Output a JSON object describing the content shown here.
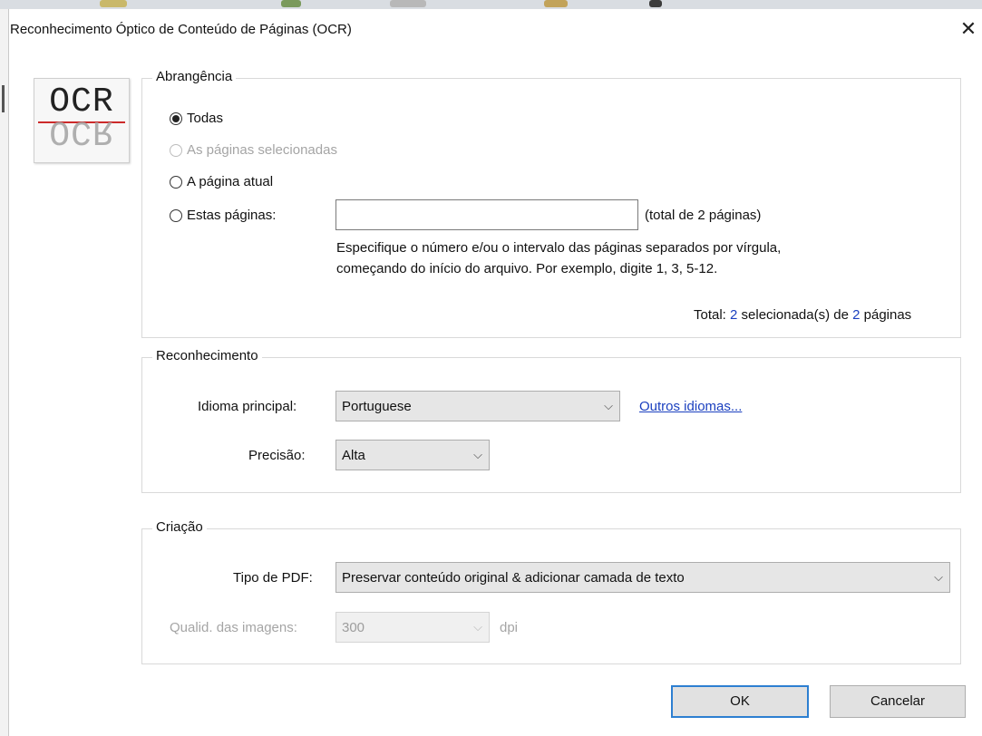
{
  "dialog": {
    "title": "Reconhecimento Óptico de Conteúdo de Páginas (OCR)",
    "close_label": "✕"
  },
  "logo": {
    "text": "OCR",
    "accent_color": "#cc2a2a"
  },
  "scope": {
    "legend": "Abrangência",
    "options": [
      {
        "label": "Todas",
        "checked": true,
        "enabled": true
      },
      {
        "label": "As páginas selecionadas",
        "checked": false,
        "enabled": false
      },
      {
        "label": "A página atual",
        "checked": false,
        "enabled": true
      },
      {
        "label": "Estas páginas:",
        "checked": false,
        "enabled": true
      }
    ],
    "pages_input": {
      "value": "",
      "placeholder": ""
    },
    "total_hint": "(total de 2 páginas)",
    "help_line1": "Especifique o número e/ou o intervalo das páginas separados por vírgula,",
    "help_line2": "começando do início do arquivo. Por exemplo, digite 1, 3, 5-12.",
    "summary": {
      "prefix": "Total: ",
      "selected": "2",
      "middle": " selecionada(s) de ",
      "total": "2",
      "suffix": " páginas"
    }
  },
  "recognition": {
    "legend": "Reconhecimento",
    "language_label": "Idioma principal:",
    "language_value": "Portuguese",
    "other_languages_link": "Outros idiomas...",
    "accuracy_label": "Precisão:",
    "accuracy_value": "Alta"
  },
  "creation": {
    "legend": "Criação",
    "pdf_type_label": "Tipo de PDF:",
    "pdf_type_value": "Preservar conteúdo original & adicionar camada de texto",
    "image_quality_label": "Qualid. das imagens:",
    "image_quality_value": "300",
    "image_quality_unit": "dpi"
  },
  "buttons": {
    "ok_label": "OK",
    "cancel_label": "Cancelar"
  },
  "colors": {
    "default_button_border": "#2d7fd1",
    "link": "#1a3fbf"
  },
  "icons": {
    "chevron": "⌵"
  }
}
